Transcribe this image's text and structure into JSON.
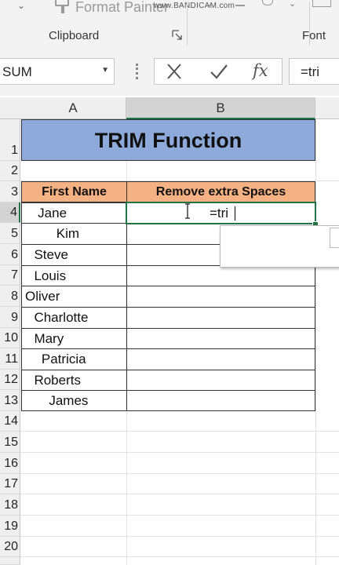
{
  "ribbon": {
    "format_painter_label": "Format Painter",
    "clipboard_group": "Clipboard",
    "font_group": "Font",
    "watermark": "www.BANDICAM.com"
  },
  "formula_bar": {
    "name_box": "SUM",
    "formula": "=tri"
  },
  "columns": [
    "A",
    "B"
  ],
  "rows": [
    "1",
    "2",
    "3",
    "4",
    "5",
    "6",
    "7",
    "8",
    "9",
    "10",
    "11",
    "12",
    "13",
    "14",
    "15",
    "16",
    "17",
    "18",
    "19",
    "20"
  ],
  "sheet": {
    "title": "TRIM Function",
    "header_a": "First Name",
    "header_b": "Remove extra Spaces",
    "editing_value": "=tri",
    "names": [
      "   Jane",
      "        Kim",
      "  Steve",
      "  Louis",
      "Oliver",
      "  Charlotte",
      "  Mary",
      "    Patricia",
      "  Roberts",
      "      James"
    ]
  },
  "colors": {
    "title_fill": "#8eaadb",
    "header_fill": "#f4b183",
    "active_cell_border": "#217346"
  },
  "icons": [
    "format-painter-icon",
    "dialog-launcher-icon",
    "cancel-icon",
    "enter-icon",
    "fx-icon",
    "dropdown-icon"
  ]
}
